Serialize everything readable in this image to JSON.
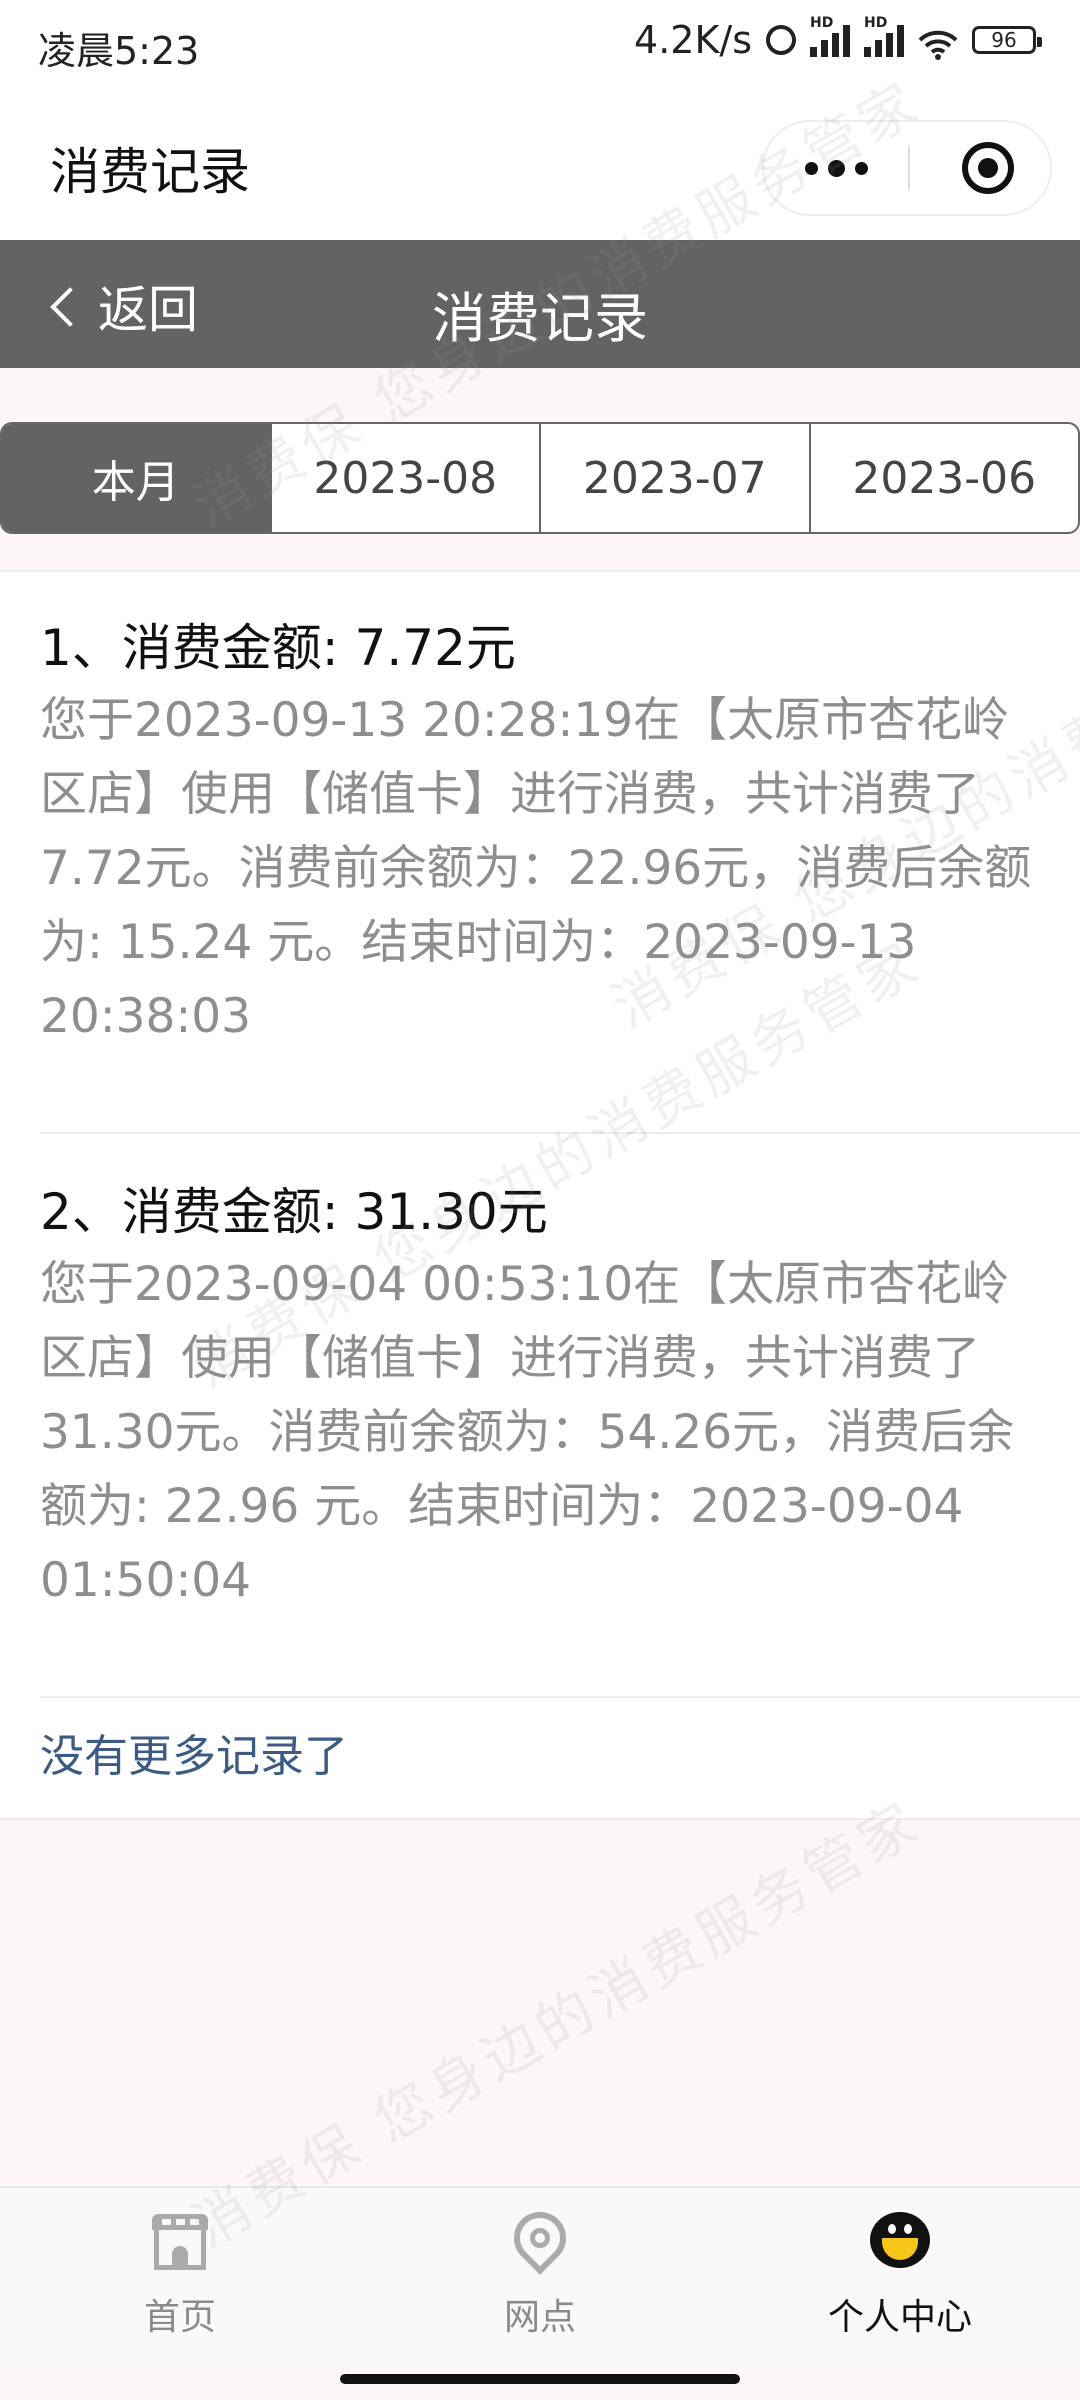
{
  "status_bar": {
    "time": "凌晨5:23",
    "speed": "4.2K/s",
    "signal_1_label": "HD",
    "signal_2_label": "HD",
    "battery": "96"
  },
  "mini_program": {
    "title": "消费记录"
  },
  "nav": {
    "back_label": "返回",
    "title": "消费记录"
  },
  "tabs": [
    {
      "label": "本月",
      "active": true
    },
    {
      "label": "2023-08",
      "active": false
    },
    {
      "label": "2023-07",
      "active": false
    },
    {
      "label": "2023-06",
      "active": false
    }
  ],
  "records": [
    {
      "title": "1、消费金额: 7.72元",
      "description": "您于2023-09-13 20:28:19在【太原市杏花岭区店】使用【储值卡】进行消费，共计消费了7.72元。消费前余额为：22.96元，消费后余额为: 15.24 元。结束时间为：2023-09-13 20:38:03"
    },
    {
      "title": "2、消费金额: 31.30元",
      "description": "您于2023-09-04 00:53:10在【太原市杏花岭区店】使用【储值卡】进行消费，共计消费了31.30元。消费前余额为：54.26元，消费后余额为: 22.96 元。结束时间为：2023-09-04 01:50:04"
    }
  ],
  "no_more": "没有更多记录了",
  "watermark": {
    "line1": "消费保 您身边的消费服务管家",
    "line2": "消费保 您身边的消费服务管家",
    "line3": "消费保 您身边的消费服务管家",
    "line4": "消费保 您身边的消费服务管家"
  },
  "tabbar": [
    {
      "label": "首页",
      "icon": "home-icon",
      "active": false
    },
    {
      "label": "网点",
      "icon": "location-pin-icon",
      "active": false
    },
    {
      "label": "个人中心",
      "icon": "smiley-face-icon",
      "active": true
    }
  ]
}
